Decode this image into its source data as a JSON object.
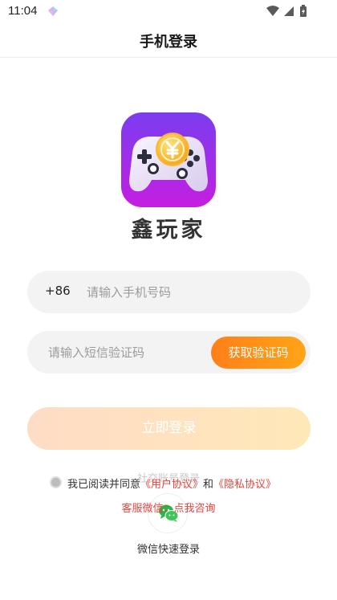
{
  "status_bar": {
    "time": "11:04"
  },
  "header": {
    "title": "手机登录"
  },
  "app": {
    "name": "鑫玩家",
    "logo_icon": "gamepad-coin-icon"
  },
  "phone_field": {
    "country_code": "+86",
    "placeholder": "请输入手机号码",
    "value": ""
  },
  "code_field": {
    "placeholder": "请输入短信验证码",
    "value": "",
    "get_code_label": "获取验证码"
  },
  "login_button": {
    "label": "立即登录"
  },
  "social_login": {
    "label": "社交账号登录",
    "wechat_label": "微信快速登录",
    "wechat_icon": "wechat-icon"
  },
  "agreement": {
    "prefix": "我已阅读并同意",
    "user_agreement": "《用户协议》",
    "conjunction": "和",
    "privacy_policy": "《隐私协议》"
  },
  "customer_service": {
    "label": "客服微信：点我咨询"
  },
  "colors": {
    "accent_orange": "#ff8a1a",
    "link_red": "#e9443c",
    "login_button_gradient_start": "#ffdcc6",
    "login_button_gradient_end": "#ffe8b8",
    "field_background": "#f3f3f3"
  }
}
